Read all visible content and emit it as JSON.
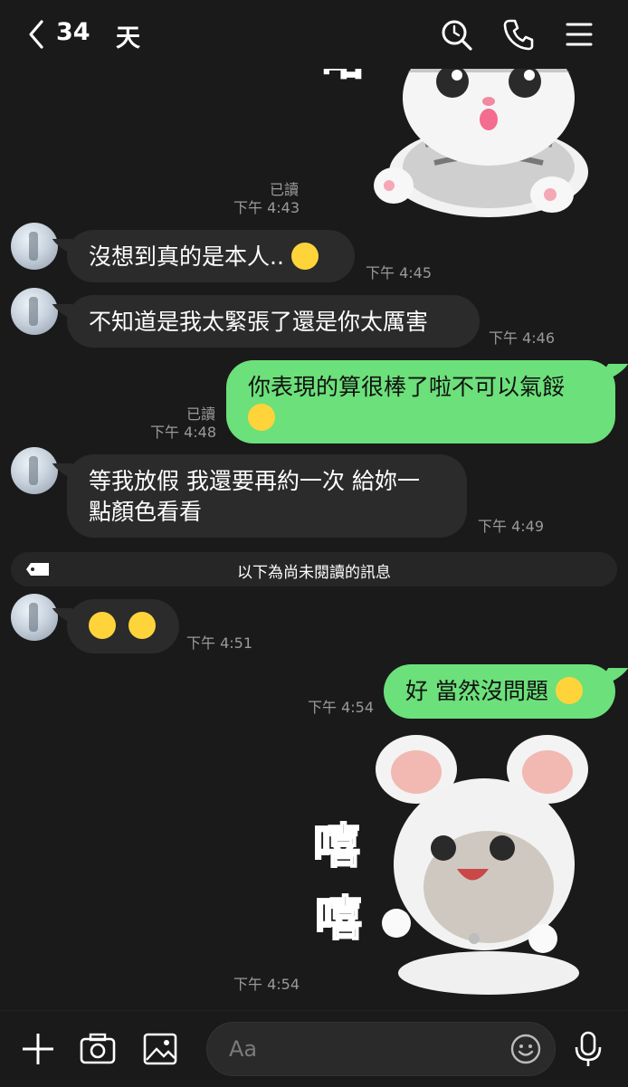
{
  "header": {
    "back_label": "<",
    "unread_count": "34",
    "chat_name": "天",
    "icons": [
      "search-icon",
      "phone-icon",
      "menu-icon"
    ]
  },
  "stickers": {
    "top_text": "略",
    "bottom_text_1": "嘻",
    "bottom_text_2": "嘻"
  },
  "messages": [
    {
      "id": "m0",
      "side": "out",
      "type": "sticker",
      "read": "已讀",
      "time": "下午 4:43"
    },
    {
      "id": "m1",
      "side": "in",
      "text": "沒想到真的是本人..",
      "emoji": "sweat-smile-emoji",
      "time": "下午 4:45"
    },
    {
      "id": "m2",
      "side": "in",
      "text": "不知道是我太緊張了還是你太厲害",
      "time": "下午 4:46"
    },
    {
      "id": "m3",
      "side": "out",
      "line1": "你表現的算很棒了啦不可以氣餒",
      "emoji": "kissing-emoji",
      "read": "已讀",
      "time": "下午 4:48"
    },
    {
      "id": "m4",
      "side": "in",
      "line1": "等我放假 我還要再約一次 給妳一",
      "line2": "點顏色看看",
      "time": "下午 4:49"
    },
    {
      "id": "m5",
      "side": "in",
      "emoji": "winking-tongue-emoji",
      "time": "下午 4:51"
    },
    {
      "id": "m6",
      "side": "out",
      "text": "好 當然沒問題",
      "emoji": "smiling-hearts-emoji",
      "time": "下午 4:54"
    },
    {
      "id": "m7",
      "side": "out",
      "type": "sticker",
      "time": "下午 4:54"
    }
  ],
  "divider": {
    "text": "以下為尚未閱讀的訊息"
  },
  "input": {
    "placeholder": "Aa"
  },
  "bottom_icons": [
    "plus-icon",
    "camera-icon",
    "image-icon",
    "emoji-icon",
    "microphone-icon"
  ],
  "colors": {
    "background": "#1a1a1a",
    "incoming_bubble": "#2b2b2b",
    "outgoing_bubble": "#6ce07a",
    "timestamp": "#9a9a9a"
  }
}
